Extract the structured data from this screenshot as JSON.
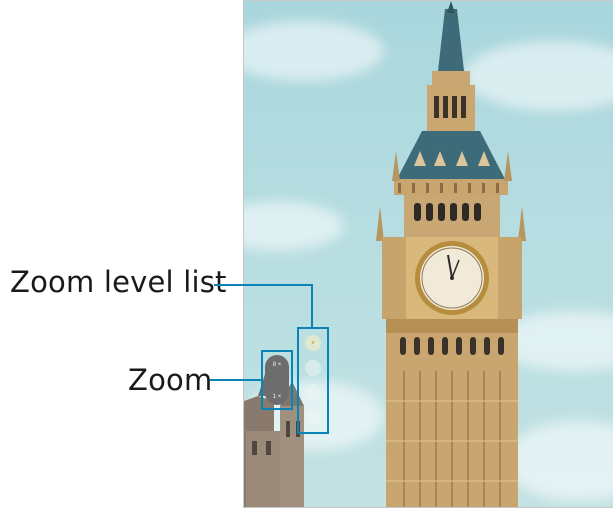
{
  "labels": {
    "zoom_level_list": "Zoom level list",
    "zoom": "Zoom"
  },
  "zoom_control": {
    "current": "8 ×",
    "min": "1 ×"
  },
  "zoom_levels": [
    "★",
    "·",
    "·",
    "·"
  ],
  "colors": {
    "callout_line": "#0a83b7",
    "sky": "#b6dde1",
    "stone": "#c9a775",
    "spire": "#35636f",
    "clock_face": "#f1ead8"
  }
}
